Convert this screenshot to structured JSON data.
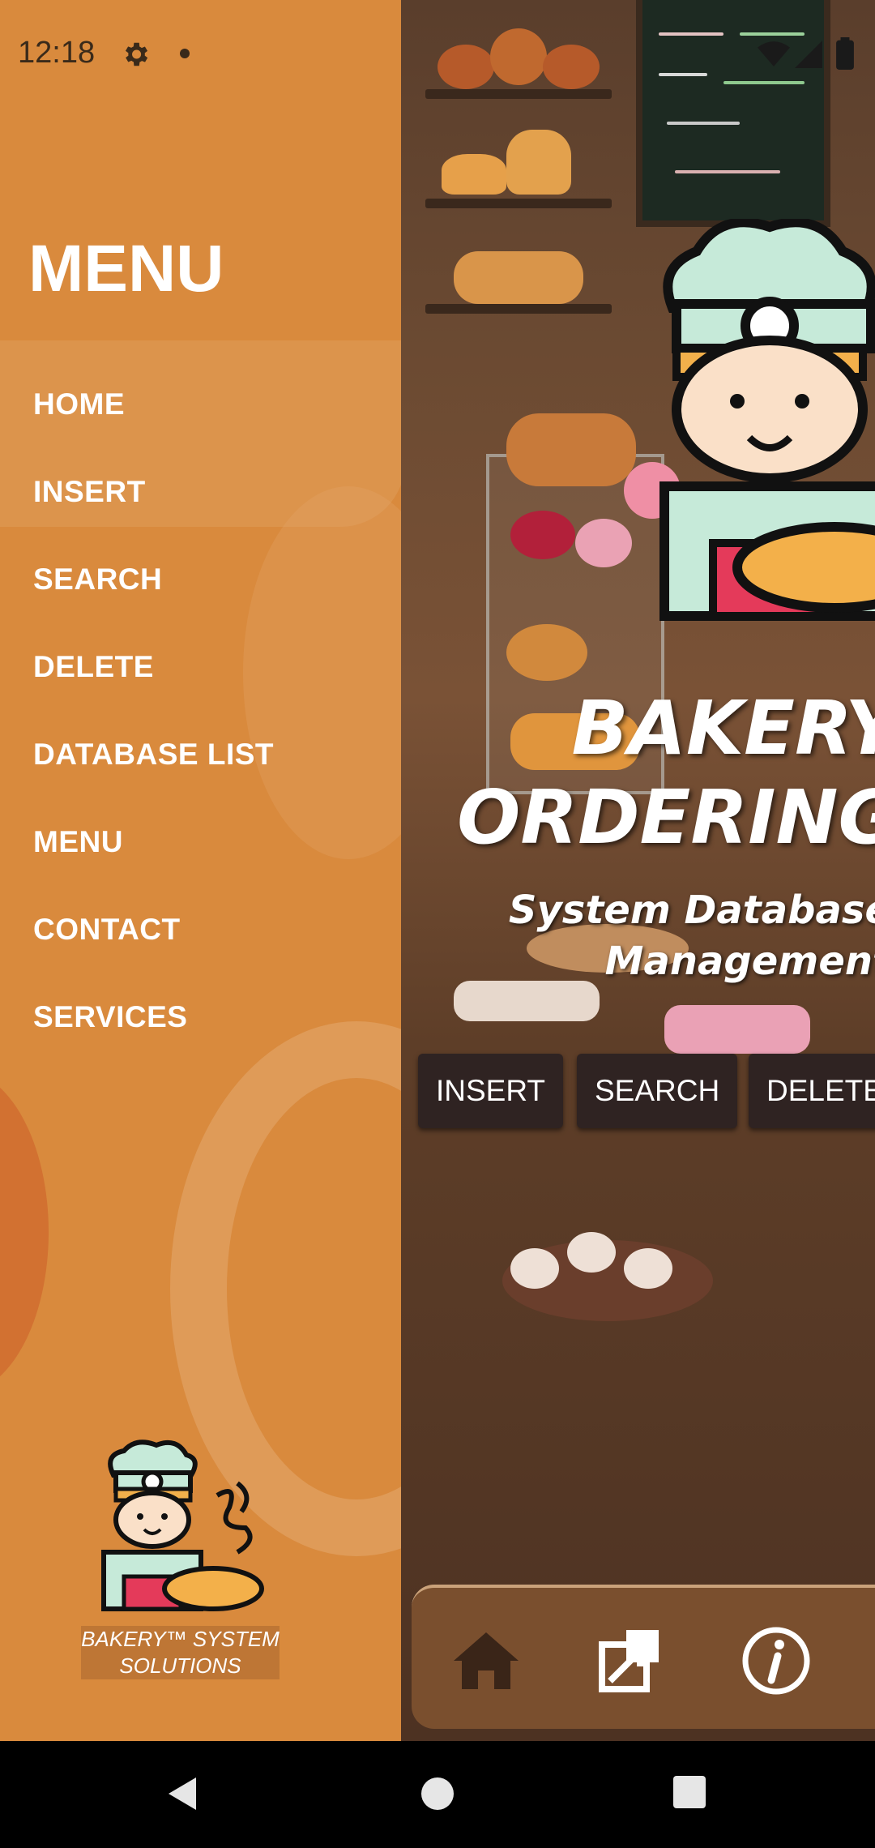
{
  "status_bar": {
    "time": "12:18",
    "icons": [
      "settings-icon",
      "notification-dot-icon",
      "wifi-icon",
      "signal-icon",
      "battery-icon"
    ]
  },
  "drawer": {
    "title": "MENU",
    "items": [
      {
        "label": "HOME"
      },
      {
        "label": "INSERT"
      },
      {
        "label": "SEARCH"
      },
      {
        "label": "DELETE"
      },
      {
        "label": "DATABASE LIST"
      },
      {
        "label": "MENU"
      },
      {
        "label": "CONTACT"
      },
      {
        "label": "SERVICES"
      }
    ],
    "brand_line1": "BAKERY™ SYSTEM",
    "brand_line2": "SOLUTIONS",
    "background_color": "#d98a3d"
  },
  "hero": {
    "title_line1": "BAKERY",
    "title_line2": "ORDERING",
    "subtitle_line1": "System Database",
    "subtitle_line2": "Management"
  },
  "quick_actions": [
    {
      "label": "INSERT"
    },
    {
      "label": "SEARCH"
    },
    {
      "label": "DELETE"
    }
  ],
  "bottom_nav": {
    "icons": [
      "home-icon",
      "open-external-icon",
      "info-icon"
    ]
  },
  "system_nav": {
    "icons": [
      "back-icon",
      "home-circle-icon",
      "recents-icon"
    ]
  },
  "colors": {
    "accent": "#d98a3d",
    "button_dark": "#2f2322",
    "bottom_bar": "#7a4f2e"
  }
}
